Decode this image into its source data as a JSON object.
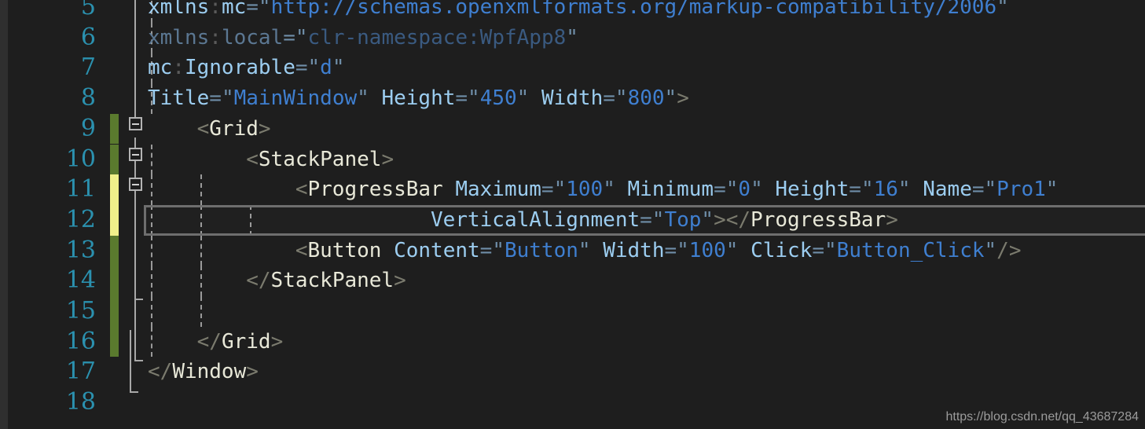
{
  "editor": {
    "app": "visual-studio-xaml-editor",
    "language": "xaml",
    "background_color": "#1e1e1e",
    "line_number_color": "#2b91af",
    "current_line": 12,
    "first_visible_line": 5,
    "last_visible_line": 18,
    "change_bar_colors": {
      "saved": "#5a7a2e",
      "unsaved": "#f0f08a"
    }
  },
  "lines": [
    {
      "number": "5",
      "indent_guides": 1,
      "change": "none",
      "fold": "none",
      "text": "xmlns:mc=\"http://schemas.openxmlformats.org/markup-compatibility/2006\"",
      "tokens": [
        {
          "t": "xmlns",
          "c": "t-attr"
        },
        {
          "t": ":",
          "c": "t-colon"
        },
        {
          "t": "mc",
          "c": "t-attr"
        },
        {
          "t": "=",
          "c": "t-eq"
        },
        {
          "t": "\"",
          "c": "t-quote"
        },
        {
          "t": "http://schemas.openxmlformats.org/markup-compatibility/2006",
          "c": "t-val"
        },
        {
          "t": "\"",
          "c": "t-quote"
        }
      ]
    },
    {
      "number": "6",
      "indent_guides": 1,
      "change": "none",
      "fold": "none",
      "text": "xmlns:local=\"clr-namespace:WpfApp8\"",
      "tokens": [
        {
          "t": "xmlns",
          "c": "t-dimattr"
        },
        {
          "t": ":",
          "c": "t-colon"
        },
        {
          "t": "local",
          "c": "t-dimattr"
        },
        {
          "t": "=",
          "c": "t-eq"
        },
        {
          "t": "\"",
          "c": "t-quote"
        },
        {
          "t": "clr-namespace:WpfApp8",
          "c": "t-dim"
        },
        {
          "t": "\"",
          "c": "t-quote"
        }
      ]
    },
    {
      "number": "7",
      "indent_guides": 1,
      "change": "none",
      "fold": "none",
      "text": "mc:Ignorable=\"d\"",
      "tokens": [
        {
          "t": "mc",
          "c": "t-attr"
        },
        {
          "t": ":",
          "c": "t-colon"
        },
        {
          "t": "Ignorable",
          "c": "t-attr"
        },
        {
          "t": "=",
          "c": "t-eq"
        },
        {
          "t": "\"",
          "c": "t-quote"
        },
        {
          "t": "d",
          "c": "t-val"
        },
        {
          "t": "\"",
          "c": "t-quote"
        }
      ]
    },
    {
      "number": "8",
      "indent_guides": 1,
      "change": "none",
      "fold": "none",
      "text": "Title=\"MainWindow\" Height=\"450\" Width=\"800\">",
      "tokens": [
        {
          "t": "Title",
          "c": "t-attr"
        },
        {
          "t": "=",
          "c": "t-eq"
        },
        {
          "t": "\"",
          "c": "t-quote"
        },
        {
          "t": "MainWindow",
          "c": "t-val"
        },
        {
          "t": "\"",
          "c": "t-quote"
        },
        {
          "t": " ",
          "c": "t-tag"
        },
        {
          "t": "Height",
          "c": "t-attr"
        },
        {
          "t": "=",
          "c": "t-eq"
        },
        {
          "t": "\"",
          "c": "t-quote"
        },
        {
          "t": "450",
          "c": "t-val"
        },
        {
          "t": "\"",
          "c": "t-quote"
        },
        {
          "t": " ",
          "c": "t-tag"
        },
        {
          "t": "Width",
          "c": "t-attr"
        },
        {
          "t": "=",
          "c": "t-eq"
        },
        {
          "t": "\"",
          "c": "t-quote"
        },
        {
          "t": "800",
          "c": "t-val"
        },
        {
          "t": "\"",
          "c": "t-quote"
        },
        {
          "t": ">",
          "c": "t-bracket"
        }
      ]
    },
    {
      "number": "9",
      "indent_guides": 0,
      "change": "saved",
      "fold": "collapse",
      "text": "    <Grid>",
      "tokens": [
        {
          "t": "    ",
          "c": "t-tag"
        },
        {
          "t": "<",
          "c": "t-bracket"
        },
        {
          "t": "Grid",
          "c": "t-tag"
        },
        {
          "t": ">",
          "c": "t-bracket"
        }
      ]
    },
    {
      "number": "10",
      "indent_guides": 1,
      "change": "saved",
      "fold": "collapse",
      "text": "        <StackPanel>",
      "tokens": [
        {
          "t": "        ",
          "c": "t-tag"
        },
        {
          "t": "<",
          "c": "t-bracket"
        },
        {
          "t": "StackPanel",
          "c": "t-tag"
        },
        {
          "t": ">",
          "c": "t-bracket"
        }
      ]
    },
    {
      "number": "11",
      "indent_guides": 2,
      "change": "unsaved",
      "fold": "collapse",
      "text": "            <ProgressBar Maximum=\"100\" Minimum=\"0\" Height=\"16\" Name=\"Pro1\"",
      "tokens": [
        {
          "t": "            ",
          "c": "t-tag"
        },
        {
          "t": "<",
          "c": "t-bracket"
        },
        {
          "t": "ProgressBar",
          "c": "t-tag"
        },
        {
          "t": " ",
          "c": "t-tag"
        },
        {
          "t": "Maximum",
          "c": "t-attr"
        },
        {
          "t": "=",
          "c": "t-eq"
        },
        {
          "t": "\"",
          "c": "t-quote"
        },
        {
          "t": "100",
          "c": "t-val"
        },
        {
          "t": "\"",
          "c": "t-quote"
        },
        {
          "t": " ",
          "c": "t-tag"
        },
        {
          "t": "Minimum",
          "c": "t-attr"
        },
        {
          "t": "=",
          "c": "t-eq"
        },
        {
          "t": "\"",
          "c": "t-quote"
        },
        {
          "t": "0",
          "c": "t-val"
        },
        {
          "t": "\"",
          "c": "t-quote"
        },
        {
          "t": " ",
          "c": "t-tag"
        },
        {
          "t": "Height",
          "c": "t-attr"
        },
        {
          "t": "=",
          "c": "t-eq"
        },
        {
          "t": "\"",
          "c": "t-quote"
        },
        {
          "t": "16",
          "c": "t-val"
        },
        {
          "t": "\"",
          "c": "t-quote"
        },
        {
          "t": " ",
          "c": "t-tag"
        },
        {
          "t": "Name",
          "c": "t-attr"
        },
        {
          "t": "=",
          "c": "t-eq"
        },
        {
          "t": "\"",
          "c": "t-quote"
        },
        {
          "t": "Pro1",
          "c": "t-val"
        },
        {
          "t": "\"",
          "c": "t-quote"
        }
      ]
    },
    {
      "number": "12",
      "indent_guides": 3,
      "change": "unsaved",
      "fold": "none",
      "current": true,
      "text": "                       VerticalAlignment=\"Top\"></ProgressBar>",
      "tokens": [
        {
          "t": "                       ",
          "c": "t-tag"
        },
        {
          "t": "VerticalAlignment",
          "c": "t-attr"
        },
        {
          "t": "=",
          "c": "t-eq"
        },
        {
          "t": "\"",
          "c": "t-quote"
        },
        {
          "t": "Top",
          "c": "t-val"
        },
        {
          "t": "\"",
          "c": "t-quote"
        },
        {
          "t": ">",
          "c": "t-bracket"
        },
        {
          "t": "</",
          "c": "t-bracket"
        },
        {
          "t": "ProgressBar",
          "c": "t-tag"
        },
        {
          "t": ">",
          "c": "t-bracket"
        }
      ]
    },
    {
      "number": "13",
      "indent_guides": 2,
      "change": "saved",
      "fold": "none",
      "text": "            <Button Content=\"Button\" Width=\"100\" Click=\"Button_Click\"/>",
      "tokens": [
        {
          "t": "            ",
          "c": "t-tag"
        },
        {
          "t": "<",
          "c": "t-bracket"
        },
        {
          "t": "Button",
          "c": "t-tag"
        },
        {
          "t": " ",
          "c": "t-tag"
        },
        {
          "t": "Content",
          "c": "t-attr"
        },
        {
          "t": "=",
          "c": "t-eq"
        },
        {
          "t": "\"",
          "c": "t-quote"
        },
        {
          "t": "Button",
          "c": "t-val"
        },
        {
          "t": "\"",
          "c": "t-quote"
        },
        {
          "t": " ",
          "c": "t-tag"
        },
        {
          "t": "Width",
          "c": "t-attr"
        },
        {
          "t": "=",
          "c": "t-eq"
        },
        {
          "t": "\"",
          "c": "t-quote"
        },
        {
          "t": "100",
          "c": "t-val"
        },
        {
          "t": "\"",
          "c": "t-quote"
        },
        {
          "t": " ",
          "c": "t-tag"
        },
        {
          "t": "Click",
          "c": "t-attr"
        },
        {
          "t": "=",
          "c": "t-eq"
        },
        {
          "t": "\"",
          "c": "t-quote"
        },
        {
          "t": "Button_Click",
          "c": "t-val"
        },
        {
          "t": "\"",
          "c": "t-quote"
        },
        {
          "t": "/>",
          "c": "t-bracket"
        }
      ]
    },
    {
      "number": "14",
      "indent_guides": 2,
      "change": "saved",
      "fold": "none",
      "text": "        </StackPanel>",
      "tokens": [
        {
          "t": "        ",
          "c": "t-tag"
        },
        {
          "t": "</",
          "c": "t-bracket"
        },
        {
          "t": "StackPanel",
          "c": "t-tag"
        },
        {
          "t": ">",
          "c": "t-bracket"
        }
      ]
    },
    {
      "number": "15",
      "indent_guides": 2,
      "change": "saved",
      "fold": "none",
      "text": "",
      "tokens": []
    },
    {
      "number": "16",
      "indent_guides": 1,
      "change": "saved",
      "fold": "none",
      "text": "    </Grid>",
      "tokens": [
        {
          "t": "    ",
          "c": "t-tag"
        },
        {
          "t": "</",
          "c": "t-bracket"
        },
        {
          "t": "Grid",
          "c": "t-tag"
        },
        {
          "t": ">",
          "c": "t-bracket"
        }
      ]
    },
    {
      "number": "17",
      "indent_guides": 0,
      "change": "none",
      "fold": "none",
      "text": "</Window>",
      "tokens": [
        {
          "t": "</",
          "c": "t-bracket"
        },
        {
          "t": "Window",
          "c": "t-tag"
        },
        {
          "t": ">",
          "c": "t-bracket"
        }
      ]
    },
    {
      "number": "18",
      "indent_guides": 0,
      "change": "none",
      "fold": "none",
      "text": "",
      "tokens": []
    }
  ],
  "watermark": {
    "text": "https://blog.csdn.net/qq_43687284"
  }
}
